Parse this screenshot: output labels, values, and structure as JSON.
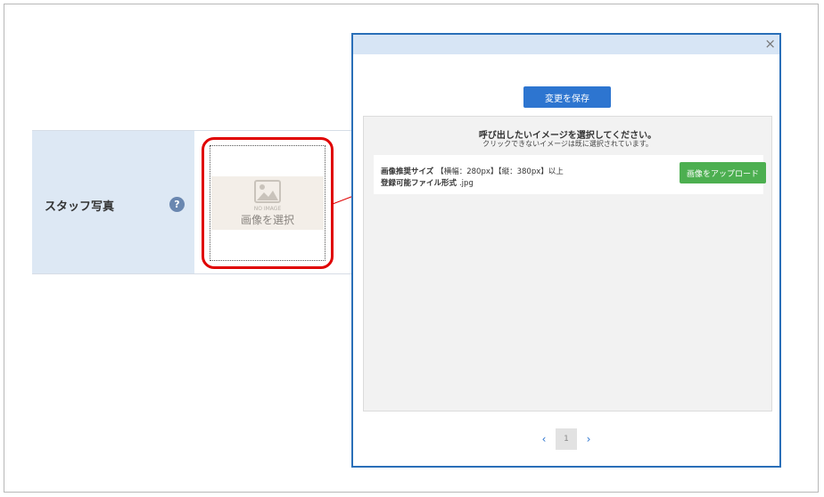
{
  "form": {
    "field_label": "スタッフ写真",
    "help_icon": "?",
    "placeholder": {
      "no_image": "NO IMAGE",
      "select_label": "画像を選択"
    }
  },
  "modal": {
    "close_icon": "×",
    "save_button": "変更を保存",
    "gallery": {
      "title": "呼び出したいイメージを選択してください。",
      "subtitle": "クリックできないイメージは既に選択されています。",
      "size_label": "画像推奨サイズ",
      "size_value": "【横幅：280px】【縦：380px】以上",
      "format_label": "登録可能ファイル形式",
      "format_value": ".jpg",
      "upload_button": "画像をアップロード"
    },
    "pagination": {
      "prev_icon": "‹",
      "current_page": "1",
      "next_icon": "›"
    }
  },
  "colors": {
    "modal_border": "#2a6fb8",
    "save_button": "#2d75d0",
    "upload_button": "#4caf50",
    "highlight": "#e00000",
    "label_cell": "#dde8f4"
  }
}
